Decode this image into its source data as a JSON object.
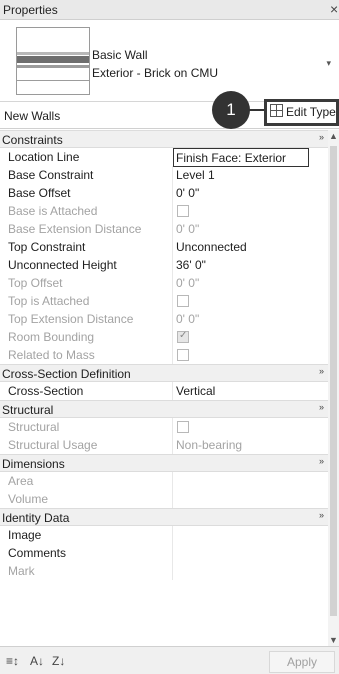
{
  "window": {
    "title": "Properties",
    "close_glyph": "×"
  },
  "type_selector": {
    "family": "Basic Wall",
    "type": "Exterior - Brick on CMU",
    "arrow": "▾"
  },
  "instance_bar": {
    "filter_label": "New Walls",
    "edit_type_label": "Edit Type",
    "edit_type_icon": "edit-type-icon",
    "callout_number": "1"
  },
  "grid": {
    "collapse_glyph": "»",
    "constraints": {
      "label": "Constraints",
      "rows": [
        {
          "name": "Location Line",
          "value": "Finish Face: Exterior"
        },
        {
          "name": "Base Constraint",
          "value": "Level 1"
        },
        {
          "name": "Base Offset",
          "value": "0'  0\""
        },
        {
          "name": "Base is Attached",
          "value": ""
        },
        {
          "name": "Base Extension Distance",
          "value": "0'  0\""
        },
        {
          "name": "Top Constraint",
          "value": "Unconnected"
        },
        {
          "name": "Unconnected Height",
          "value": "36'  0\""
        },
        {
          "name": "Top Offset",
          "value": "0'  0\""
        },
        {
          "name": "Top is Attached",
          "value": ""
        },
        {
          "name": "Top Extension Distance",
          "value": "0'  0\""
        },
        {
          "name": "Room Bounding",
          "value": ""
        },
        {
          "name": "Related to Mass",
          "value": ""
        }
      ]
    },
    "cross_section": {
      "label": "Cross-Section Definition",
      "rows": [
        {
          "name": "Cross-Section",
          "value": "Vertical"
        }
      ]
    },
    "structural": {
      "label": "Structural",
      "rows": [
        {
          "name": "Structural",
          "value": ""
        },
        {
          "name": "Structural Usage",
          "value": "Non-bearing"
        }
      ]
    },
    "dimensions": {
      "label": "Dimensions",
      "rows": [
        {
          "name": "Area",
          "value": ""
        },
        {
          "name": "Volume",
          "value": ""
        }
      ]
    },
    "identity": {
      "label": "Identity Data",
      "rows": [
        {
          "name": "Image",
          "value": ""
        },
        {
          "name": "Comments",
          "value": ""
        },
        {
          "name": "Mark",
          "value": ""
        }
      ]
    },
    "checkbox_states": {
      "base_is_attached": false,
      "top_is_attached": false,
      "room_bounding": true,
      "related_to_mass": false,
      "structural": false
    }
  },
  "scrollbar": {
    "up": "▲",
    "down": "▼"
  },
  "bottom_bar": {
    "icons": [
      "properties-list-icon",
      "sort-ascending-icon",
      "sort-descending-icon"
    ],
    "icon_glyphs": [
      "≡↕",
      "A↓",
      "Z↓"
    ],
    "apply_label": "Apply"
  },
  "colors": {
    "preview_bands": [
      "#b8b8b8",
      "#6e6e6e",
      "#9c9c9c"
    ]
  }
}
